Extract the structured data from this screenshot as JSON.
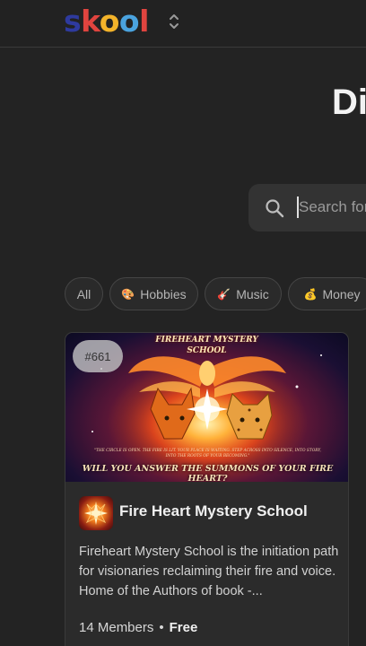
{
  "header": {
    "logo": {
      "s": "s",
      "k": "k",
      "o1": "o",
      "o2": "o",
      "l": "l"
    },
    "switcher_icon": "chevron-up-down-icon"
  },
  "hero": {
    "title": "Di"
  },
  "search": {
    "placeholder": "Search for anything",
    "value": "",
    "icon": "search-icon"
  },
  "categories": [
    {
      "label": "All",
      "emoji": ""
    },
    {
      "label": "Hobbies",
      "emoji": "🎨"
    },
    {
      "label": "Music",
      "emoji": "🎸"
    },
    {
      "label": "Money",
      "emoji": "💰"
    }
  ],
  "card": {
    "rank": "#661",
    "banner": {
      "title_line1": "FIREHEART MYSTERY",
      "title_line2": "SCHOOL",
      "quote": "\"THE CIRCLE IS OPEN. THE FIRE IS LIT. YOUR PLACE IS WAITING. STEP ACROSS INTO SILENCE, INTO STORY, INTO THE ROOTS OF YOUR BECOMING.\"",
      "summons": "WILL YOU ANSWER THE SUMMONS OF YOUR FIRE HEART?"
    },
    "name": "Fire Heart Mystery School",
    "description": "Fireheart Mystery School is the initiation path for visionaries reclaiming their fire and voice. Home of the Authors of book -...",
    "members": "14 Members",
    "separator": "•",
    "price": "Free"
  },
  "colors": {
    "background": "#232323",
    "card": "#2b2b2b",
    "logo_blue": "#2e3a9e",
    "logo_red": "#e0443f",
    "logo_yellow": "#f3b32a",
    "logo_lightblue": "#4aa3df"
  }
}
